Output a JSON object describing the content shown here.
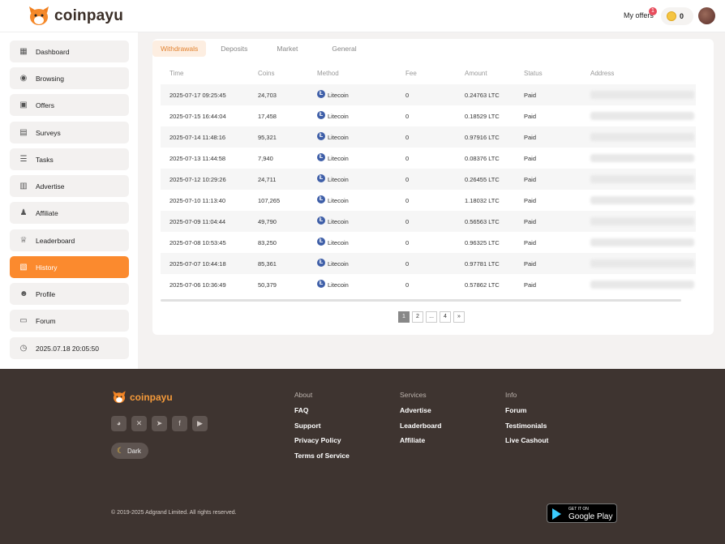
{
  "header": {
    "logo_text": "coinpayu",
    "my_offers_label": "My offers",
    "offers_badge": "1",
    "coin_balance": "0"
  },
  "sidebar": {
    "items": [
      {
        "label": "Dashboard",
        "icon": "dashboard-icon"
      },
      {
        "label": "Browsing",
        "icon": "eye-icon"
      },
      {
        "label": "Offers",
        "icon": "offers-icon"
      },
      {
        "label": "Surveys",
        "icon": "surveys-icon"
      },
      {
        "label": "Tasks",
        "icon": "tasks-icon"
      },
      {
        "label": "Advertise",
        "icon": "advertise-icon"
      },
      {
        "label": "Affiliate",
        "icon": "affiliate-icon"
      },
      {
        "label": "Leaderboard",
        "icon": "trophy-icon"
      },
      {
        "label": "History",
        "icon": "history-icon"
      },
      {
        "label": "Profile",
        "icon": "profile-icon"
      },
      {
        "label": "Forum",
        "icon": "forum-icon"
      }
    ],
    "datetime": "2025.07.18 20:05:50"
  },
  "tabs": [
    "Withdrawals",
    "Deposits",
    "Market",
    "General"
  ],
  "table": {
    "headers": [
      "Time",
      "Coins",
      "Method",
      "Fee",
      "Amount",
      "Status",
      "Address"
    ],
    "rows": [
      {
        "time": "2025-07-17 09:25:45",
        "coins": "24,703",
        "method": "Litecoin",
        "fee": "0",
        "amount": "0.24763 LTC",
        "status": "Paid"
      },
      {
        "time": "2025-07-15 16:44:04",
        "coins": "17,458",
        "method": "Litecoin",
        "fee": "0",
        "amount": "0.18529 LTC",
        "status": "Paid"
      },
      {
        "time": "2025-07-14 11:48:16",
        "coins": "95,321",
        "method": "Litecoin",
        "fee": "0",
        "amount": "0.97916 LTC",
        "status": "Paid"
      },
      {
        "time": "2025-07-13 11:44:58",
        "coins": "7,940",
        "method": "Litecoin",
        "fee": "0",
        "amount": "0.08376 LTC",
        "status": "Paid"
      },
      {
        "time": "2025-07-12 10:29:26",
        "coins": "24,711",
        "method": "Litecoin",
        "fee": "0",
        "amount": "0.26455 LTC",
        "status": "Paid"
      },
      {
        "time": "2025-07-10 11:13:40",
        "coins": "107,265",
        "method": "Litecoin",
        "fee": "0",
        "amount": "1.18032 LTC",
        "status": "Paid"
      },
      {
        "time": "2025-07-09 11:04:44",
        "coins": "49,790",
        "method": "Litecoin",
        "fee": "0",
        "amount": "0.56563 LTC",
        "status": "Paid"
      },
      {
        "time": "2025-07-08 10:53:45",
        "coins": "83,250",
        "method": "Litecoin",
        "fee": "0",
        "amount": "0.96325 LTC",
        "status": "Paid"
      },
      {
        "time": "2025-07-07 10:44:18",
        "coins": "85,361",
        "method": "Litecoin",
        "fee": "0",
        "amount": "0.97781 LTC",
        "status": "Paid"
      },
      {
        "time": "2025-07-06 10:36:49",
        "coins": "50,379",
        "method": "Litecoin",
        "fee": "0",
        "amount": "0.57862 LTC",
        "status": "Paid"
      }
    ]
  },
  "pagination": [
    "1",
    "2",
    "...",
    "4",
    "»"
  ],
  "footer": {
    "logo_text": "coinpayu",
    "dark_label": "Dark",
    "columns": [
      {
        "title": "About",
        "links": [
          "FAQ",
          "Support",
          "Privacy Policy",
          "Terms of Service"
        ]
      },
      {
        "title": "Services",
        "links": [
          "Advertise",
          "Leaderboard",
          "Affiliate"
        ]
      },
      {
        "title": "Info",
        "links": [
          "Forum",
          "Testimonials",
          "Live Cashout"
        ]
      }
    ],
    "copyright": "© 2019-2025 Adgrand Limited. All rights reserved.",
    "gplay_small": "GET IT ON",
    "gplay_big": "Google Play"
  }
}
